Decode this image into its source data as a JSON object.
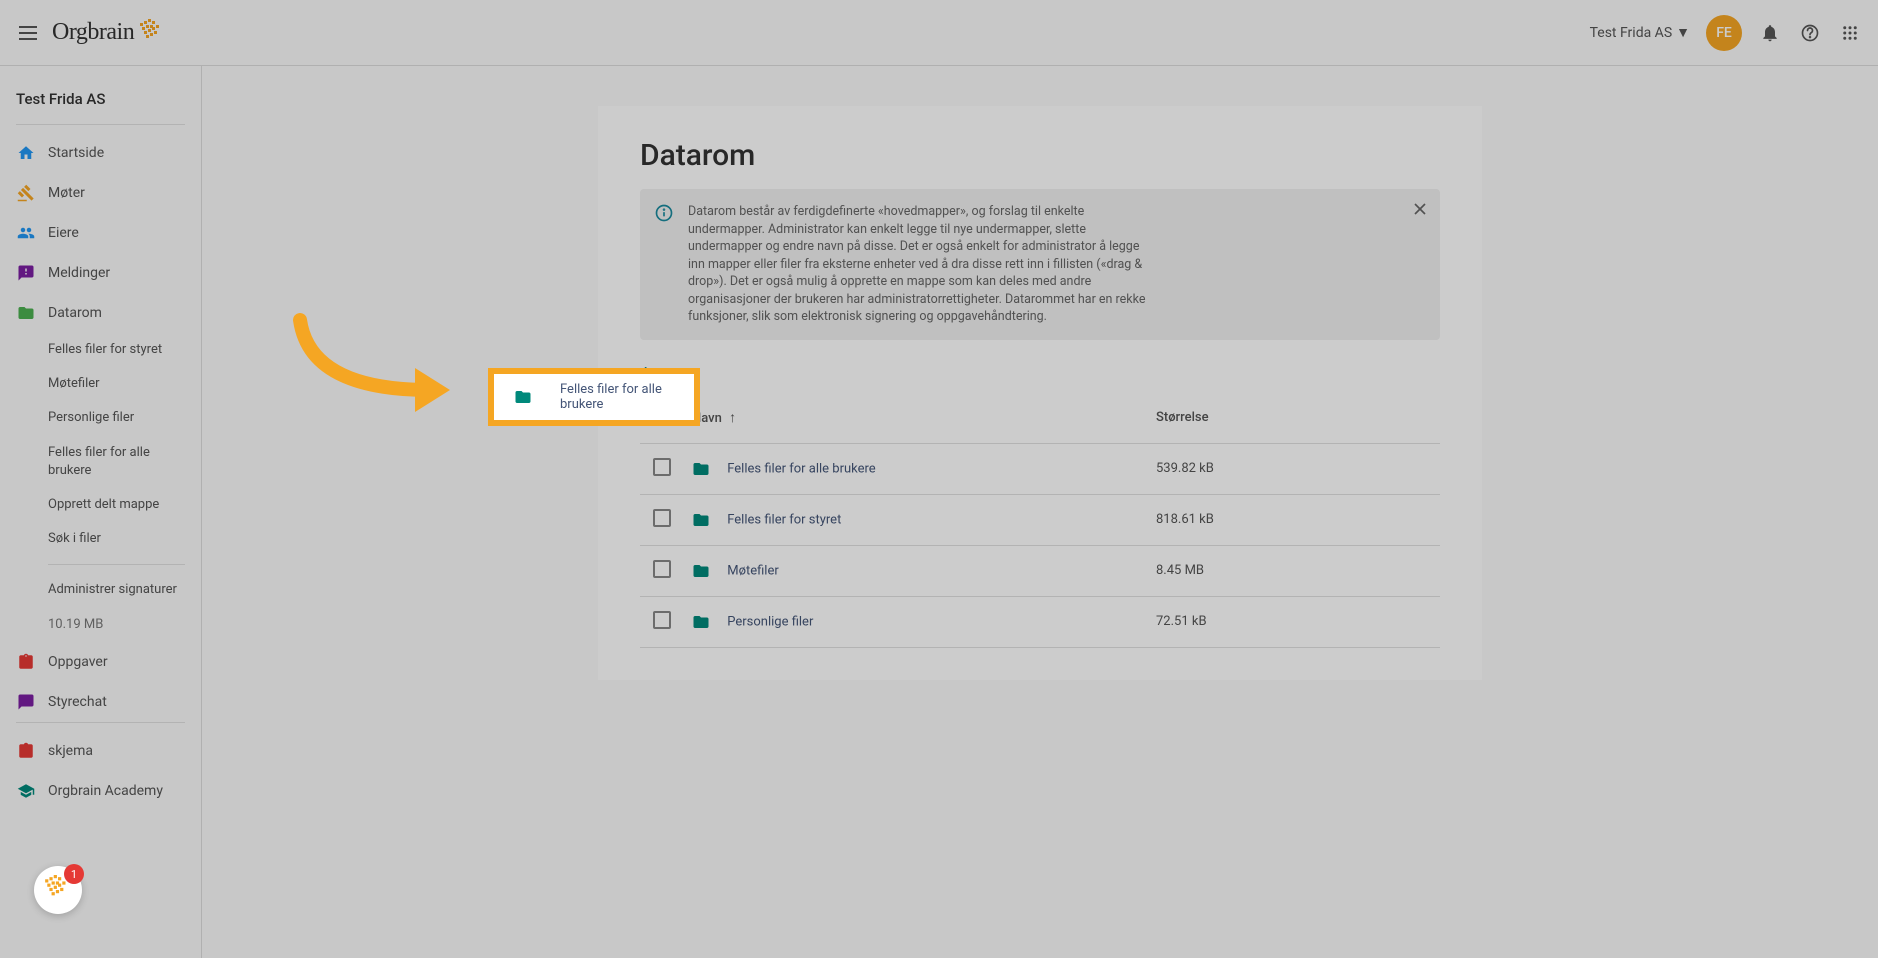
{
  "header": {
    "org_name": "Test Frida AS",
    "avatar_initials": "FE",
    "logo_text": "Orgbrain"
  },
  "sidebar": {
    "title": "Test Frida AS",
    "items": [
      {
        "label": "Startside"
      },
      {
        "label": "Møter"
      },
      {
        "label": "Eiere"
      },
      {
        "label": "Meldinger"
      },
      {
        "label": "Datarom"
      }
    ],
    "data_room_sub": [
      {
        "label": "Felles filer for styret"
      },
      {
        "label": "Møtefiler"
      },
      {
        "label": "Personlige filer"
      },
      {
        "label": "Felles filer for alle brukere"
      },
      {
        "label": "Opprett delt mappe"
      },
      {
        "label": "Søk i filer"
      }
    ],
    "data_room_admin": [
      {
        "label": "Administrer signaturer"
      },
      {
        "label": "10.19 MB"
      }
    ],
    "bottom_items": [
      {
        "label": "Oppgaver"
      },
      {
        "label": "Styrechat"
      },
      {
        "label": "skjema"
      },
      {
        "label": "Orgbrain Academy"
      }
    ]
  },
  "main": {
    "title": "Datarom",
    "info_text": "Datarom består av ferdigdefinerte «hovedmapper», og forslag til enkelte undermapper. Administrator kan enkelt legge til nye undermapper, slette undermapper og endre navn på disse. Det er også enkelt for administrator å legge inn mapper eller filer fra eksterne enheter ved å dra disse rett inn i fillisten («drag & drop»). Det er også mulig å opprette en mappe som kan deles med andre organisasjoner der brukeren har administratorrettigheter. Datarommet har en rekke funksjoner, slik som elektronisk signering og oppgavehåndtering.",
    "breadcrumb": "/",
    "columns": {
      "name": "Navn",
      "size": "Størrelse"
    },
    "rows": [
      {
        "name": "Felles filer for alle brukere",
        "size": "539.82 kB"
      },
      {
        "name": "Felles filer for styret",
        "size": "818.61 kB"
      },
      {
        "name": "Møtefiler",
        "size": "8.45 MB"
      },
      {
        "name": "Personlige filer",
        "size": "72.51 kB"
      }
    ]
  },
  "highlight": {
    "label": "Felles filer for alle brukere"
  },
  "floating": {
    "badge_count": "1"
  }
}
